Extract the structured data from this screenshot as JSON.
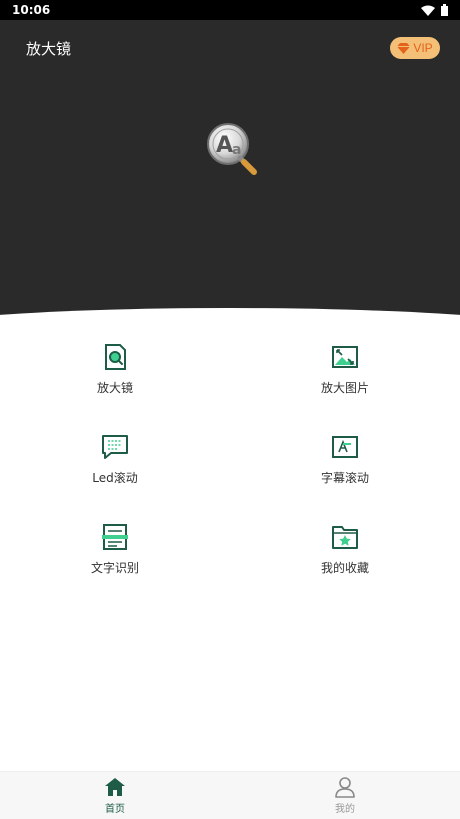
{
  "status_bar": {
    "time": "10:06"
  },
  "header": {
    "title": "放大镜",
    "vip_label": "VIP"
  },
  "features": [
    {
      "label": "放大镜",
      "icon": "magnifier-doc-icon"
    },
    {
      "label": "放大图片",
      "icon": "enlarge-image-icon"
    },
    {
      "label": "Led滚动",
      "icon": "led-message-icon"
    },
    {
      "label": "字幕滚动",
      "icon": "subtitle-scroll-icon"
    },
    {
      "label": "文字识别",
      "icon": "text-recognition-icon"
    },
    {
      "label": "我的收藏",
      "icon": "favorites-folder-icon"
    }
  ],
  "bottom_nav": {
    "home_label": "首页",
    "mine_label": "我的"
  },
  "colors": {
    "accent": "#1e5c47",
    "accent_light": "#3fcf8e",
    "header_bg": "#2a2a2a",
    "vip_bg": "#f4c077",
    "vip_text": "#e4621a"
  }
}
